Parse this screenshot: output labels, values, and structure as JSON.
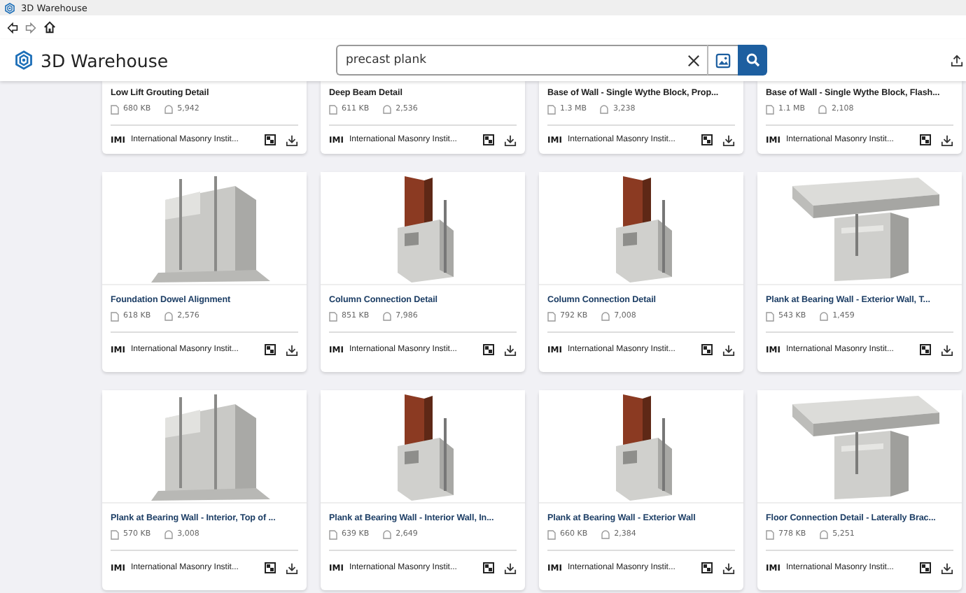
{
  "window": {
    "title": "3D Warehouse"
  },
  "header": {
    "logo": "3D Warehouse",
    "search": {
      "value": "precast plank"
    }
  },
  "cards": [
    {
      "title": "Low Lift Grouting Detail",
      "size": "680 KB",
      "views": "5,942",
      "author": "International Masonry Instit...",
      "logo": "IMI"
    },
    {
      "title": "Deep Beam Detail",
      "size": "611 KB",
      "views": "2,536",
      "author": "International Masonry Instit...",
      "logo": "IMI"
    },
    {
      "title": "Base of Wall - Single Wythe Block, Prop...",
      "size": "1.3 MB",
      "views": "3,238",
      "author": "International Masonry Instit...",
      "logo": "IMI"
    },
    {
      "title": "Base of Wall - Single Wythe Block, Flash...",
      "size": "1.1 MB",
      "views": "2,108",
      "author": "International Masonry Instit...",
      "logo": "IMI"
    },
    {
      "title": "Foundation Dowel Alignment",
      "size": "618 KB",
      "views": "2,576",
      "author": "International Masonry Instit...",
      "logo": "IMI"
    },
    {
      "title": "Column Connection Detail",
      "size": "851 KB",
      "views": "7,986",
      "author": "International Masonry Instit...",
      "logo": "IMI"
    },
    {
      "title": "Column Connection Detail",
      "size": "792 KB",
      "views": "7,008",
      "author": "International Masonry Instit...",
      "logo": "IMI"
    },
    {
      "title": "Plank at Bearing Wall - Exterior Wall, T...",
      "size": "543 KB",
      "views": "1,459",
      "author": "International Masonry Instit...",
      "logo": "IMI"
    },
    {
      "title": "Plank at Bearing Wall - Interior, Top of ...",
      "size": "570 KB",
      "views": "3,008",
      "author": "International Masonry Instit...",
      "logo": "IMI"
    },
    {
      "title": "Plank at Bearing Wall - Interior Wall, In...",
      "size": "639 KB",
      "views": "2,649",
      "author": "International Masonry Instit...",
      "logo": "IMI"
    },
    {
      "title": "Plank at Bearing Wall - Exterior Wall",
      "size": "660 KB",
      "views": "2,384",
      "author": "International Masonry Instit...",
      "logo": "IMI"
    },
    {
      "title": "Floor Connection Detail - Laterally Brac...",
      "size": "778 KB",
      "views": "5,251",
      "author": "International Masonry Instit...",
      "logo": "IMI"
    }
  ]
}
